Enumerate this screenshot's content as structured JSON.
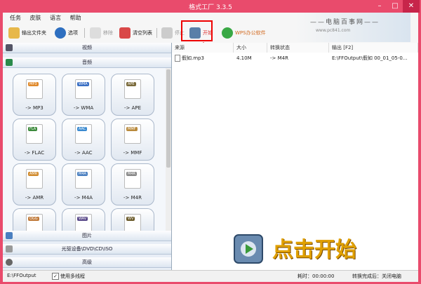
{
  "window": {
    "title": "格式工厂 3.3.5",
    "minimize": "–",
    "maximize": "□",
    "close": "✕"
  },
  "menu": [
    "任务",
    "皮肤",
    "语言",
    "帮助"
  ],
  "toolbar": {
    "output_folder": "输出文件夹",
    "options": "选项",
    "remove": "移除",
    "clear_list": "清空列表",
    "stop": "停止",
    "start": "开始",
    "wps": "WPS办公软件"
  },
  "banner": {
    "text": "——电脑百事网——",
    "url": "www.pc841.com"
  },
  "categories": {
    "video": "视频",
    "audio": "音频",
    "picture": "图片",
    "disc": "光驱设备\\DVD\\CD\\ISO",
    "advanced": "高级"
  },
  "formats": [
    {
      "tag": "MP3",
      "label": "-> MP3"
    },
    {
      "tag": "WMA",
      "label": "-> WMA"
    },
    {
      "tag": "APE",
      "label": "-> APE"
    },
    {
      "tag": "FLA",
      "label": "-> FLAC"
    },
    {
      "tag": "AAC",
      "label": "-> AAC"
    },
    {
      "tag": "MMF",
      "label": "-> MMF"
    },
    {
      "tag": "AMR",
      "label": "-> AMR"
    },
    {
      "tag": "M4A",
      "label": "-> M4A"
    },
    {
      "tag": "M4R",
      "label": "-> M4R"
    },
    {
      "tag": "OGG",
      "label": ""
    },
    {
      "tag": "WAV",
      "label": ""
    },
    {
      "tag": "WV",
      "label": ""
    }
  ],
  "table": {
    "headers": [
      "来源",
      "大小",
      "转换状态",
      "输出 [F2]"
    ],
    "rows": [
      {
        "source": "假如.mp3",
        "size": "4.10M",
        "status": "-> M4R",
        "output": "E:\\FFOutput\\假如 00_01_05-0..."
      }
    ]
  },
  "overlay": {
    "text": "点击开始"
  },
  "status": {
    "output_path": "E:\\FFOutput",
    "multithread": "使用多线程",
    "elapsed": "耗时：00:00:00",
    "after": "转换完成后：关闭电脑"
  },
  "colors": {
    "titlebar": "#e94b6c",
    "highlight": "#e00000"
  }
}
